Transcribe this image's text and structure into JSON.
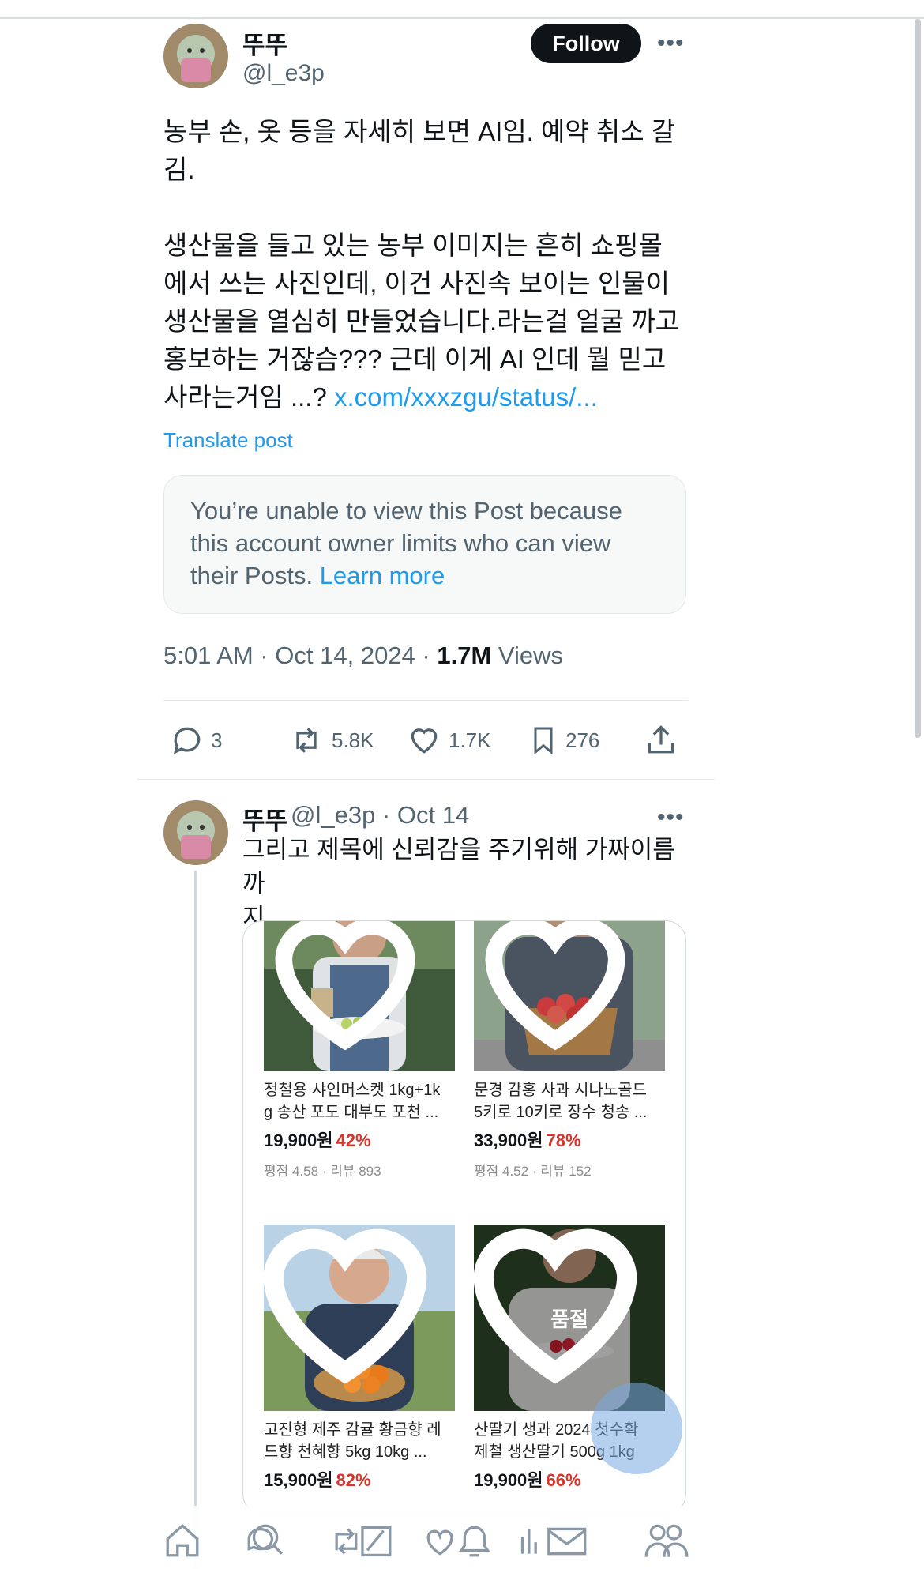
{
  "tweet": {
    "display_name": "뚜뚜",
    "handle": "@l_e3p",
    "follow_label": "Follow",
    "more_label": "•••",
    "lines": [
      "농부 손, 옷 등을 자세히 보면 AI임. 예약 취소 갈",
      "김.",
      "생산물을 들고 있는 농부 이미지는 흔히 쇼핑몰",
      "에서 쓰는 사진인데, 이건 사진속 보이는 인물이",
      "생산물을 열심히 만들었습니다.라는걸 얼굴 까고",
      "홍보하는 거잖슴??? 근데 이게 AI 인데 뭘 믿고"
    ],
    "last_line_prefix": "사라는거임 ...? ",
    "link_text": "x.com/xxxzgu/status/...",
    "translate_label": "Translate post",
    "notice_text": "You’re unable to view this Post because this account owner limits who can view their Posts.",
    "notice_link": "Learn more",
    "time": "5:01 AM · Oct 14, 2024 · ",
    "views_count": "1.7M",
    "views_label": " Views",
    "replies": "3",
    "reposts": "5.8K",
    "likes": "1.7K",
    "bookmarks": "276"
  },
  "reply": {
    "display_name": "뚜뚜",
    "meta": "@l_e3p · Oct 14",
    "more_label": "•••",
    "line1": "그리고 제목에 신뢰감을 주기위해 가짜이름까",
    "line2": "지 ..."
  },
  "products": [
    {
      "title1": "정철용 샤인머스켓 1kg+1k",
      "title2": "g 송산 포도 대부도 포천 ...",
      "price": "19,900원",
      "discount": "42%",
      "rating": "평점 4.58 · 리뷰 893"
    },
    {
      "title1": "문경 감홍 사과 시나노골드",
      "title2": "5키로 10키로 장수 청송 ...",
      "price": "33,900원",
      "discount": "78%",
      "rating": "평점 4.52 · 리뷰 152"
    },
    {
      "title1": "고진형 제주 감귤 황금향 레",
      "title2": "드향 천혜향 5kg 10kg ...",
      "price": "15,900원",
      "discount": "82%",
      "rating": ""
    },
    {
      "title1": "산딸기 생과 2024 첫수확",
      "title2": "제철 생산딸기 500g 1kg",
      "price": "19,900원",
      "discount": "66%",
      "rating": "",
      "badge": "품절"
    }
  ],
  "colors": {
    "accent": "#1d9bf0",
    "text": "#0f1419",
    "muted": "#536471",
    "discount": "#d9342b"
  }
}
